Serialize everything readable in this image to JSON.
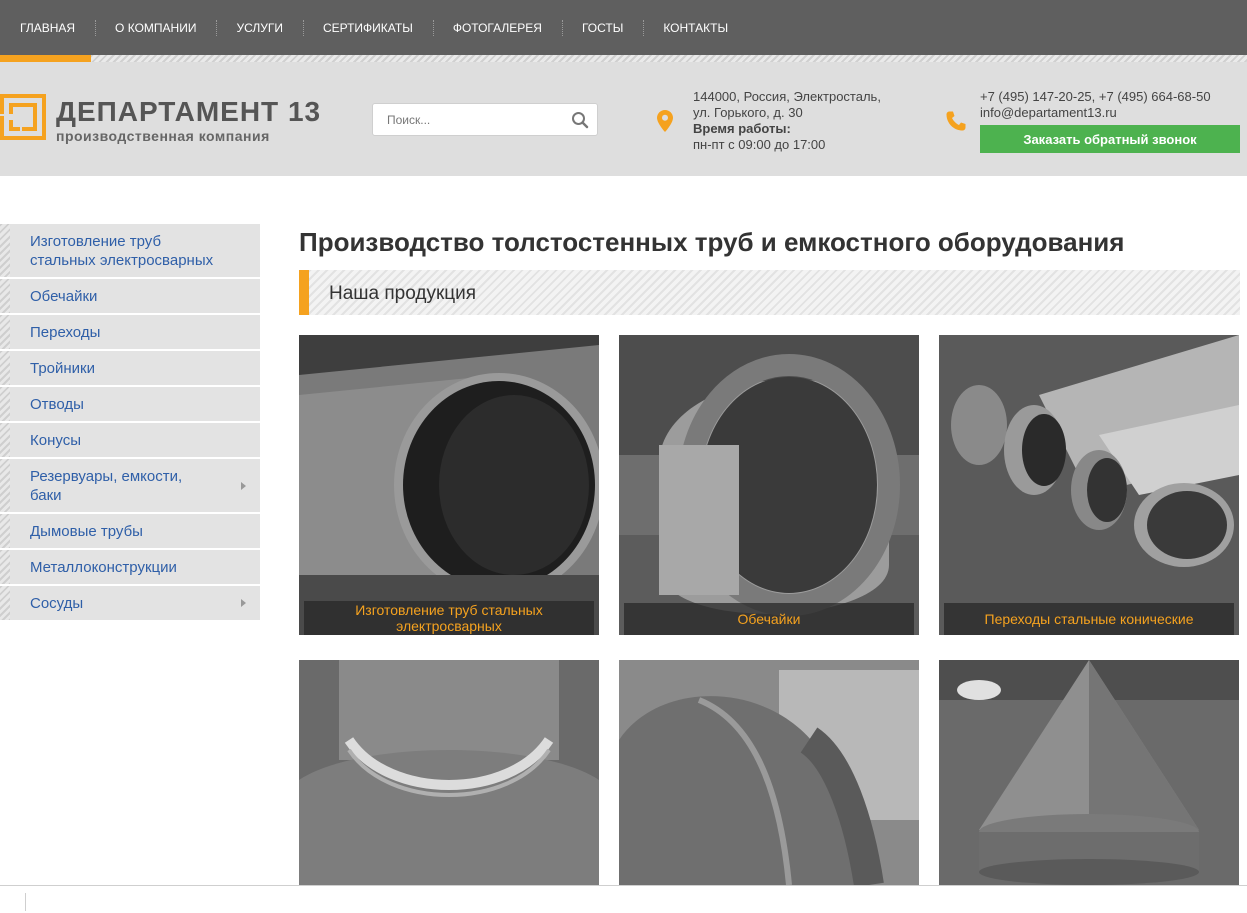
{
  "nav": {
    "items": [
      "ГЛАВНАЯ",
      "О КОМПАНИИ",
      "УСЛУГИ",
      "СЕРТИФИКАТЫ",
      "ФОТОГАЛЕРЕЯ",
      "ГОСТЫ",
      "КОНТАКТЫ"
    ],
    "active_index": 0
  },
  "logo": {
    "title": "ДЕПАРТАМЕНТ 13",
    "subtitle": "производственная компания"
  },
  "search": {
    "placeholder": "Поиск..."
  },
  "address": {
    "line1": "144000, Россия, Электросталь,",
    "line2": "ул. Горького, д. 30",
    "hours_label": "Время работы:",
    "hours": "пн-пт с 09:00 до 17:00"
  },
  "contacts": {
    "phones": "+7 (495) 147-20-25, +7 (495) 664-68-50",
    "email": "info@departament13.ru",
    "callback_label": "Заказать обратный звонок"
  },
  "sidebar": {
    "items": [
      {
        "label": "Изготовление труб стальных электросварных",
        "has_submenu": false
      },
      {
        "label": "Обечайки",
        "has_submenu": false
      },
      {
        "label": "Переходы",
        "has_submenu": false
      },
      {
        "label": "Тройники",
        "has_submenu": false
      },
      {
        "label": "Отводы",
        "has_submenu": false
      },
      {
        "label": "Конусы",
        "has_submenu": false
      },
      {
        "label": "Резервуары, емкости, баки",
        "has_submenu": true
      },
      {
        "label": "Дымовые трубы",
        "has_submenu": false
      },
      {
        "label": "Металлоконструкции",
        "has_submenu": false
      },
      {
        "label": "Сосуды",
        "has_submenu": true
      }
    ]
  },
  "main": {
    "title": "Производство толстостенных труб и емкостного оборудования",
    "section_title": "Наша продукция",
    "products": [
      {
        "label": "Изготовление труб стальных электросварных",
        "image": "large-steel-pipe"
      },
      {
        "label": "Обечайки",
        "image": "steel-shell-ring"
      },
      {
        "label": "Переходы стальные конические",
        "image": "conical-reducers"
      },
      {
        "label": "",
        "image": "welded-tee"
      },
      {
        "label": "",
        "image": "pipe-elbow"
      },
      {
        "label": "",
        "image": "steel-cone"
      }
    ]
  },
  "colors": {
    "accent": "#f5a21f",
    "nav_bg": "#5f5f5f",
    "header_bg": "#dedede",
    "button_green": "#4db24f",
    "link_blue": "#2f5fa8"
  }
}
